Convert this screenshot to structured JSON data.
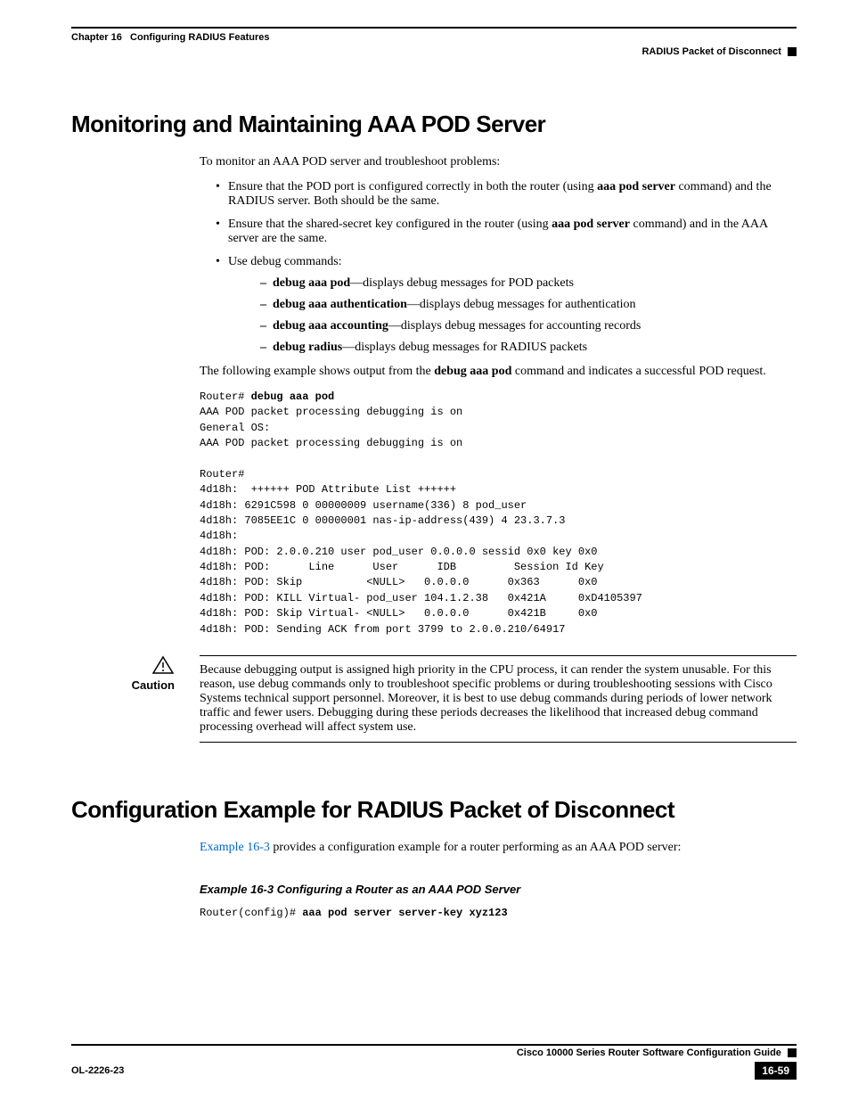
{
  "header": {
    "chapter": "Chapter 16",
    "chapter_title": "Configuring RADIUS Features",
    "section": "RADIUS Packet of Disconnect"
  },
  "h1_a": "Monitoring and Maintaining AAA POD Server",
  "intro_a": "To monitor an AAA POD server and troubleshoot problems:",
  "bullet1_pre": "Ensure that the POD port is configured correctly in both the router (using ",
  "bullet1_cmd": "aaa pod server",
  "bullet1_post": " command) and the RADIUS server. Both should be the same.",
  "bullet2_pre": "Ensure that the shared-secret key configured in the router (using ",
  "bullet2_cmd": "aaa pod server",
  "bullet2_post": " command) and in the AAA server are the same.",
  "bullet3": "Use debug commands:",
  "sub1_cmd": "debug aaa pod",
  "sub1_desc": "—displays debug messages for POD packets",
  "sub2_cmd": "debug aaa authentication",
  "sub2_desc": "—displays debug messages for authentication",
  "sub3_cmd": "debug aaa accounting",
  "sub3_desc": "—displays debug messages for accounting records",
  "sub4_cmd": "debug radius",
  "sub4_desc": "—displays debug messages for RADIUS packets",
  "example_lead_pre": "The following example shows output from the ",
  "example_lead_cmd": "debug aaa pod",
  "example_lead_post": " command and indicates a successful POD request.",
  "code_prompt": "Router# ",
  "code_cmd": "debug aaa pod",
  "code_body": "AAA POD packet processing debugging is on\nGeneral OS:\nAAA POD packet processing debugging is on\n\nRouter#\n4d18h:  ++++++ POD Attribute List ++++++\n4d18h: 6291C598 0 00000009 username(336) 8 pod_user\n4d18h: 7085EE1C 0 00000001 nas-ip-address(439) 4 23.3.7.3\n4d18h:\n4d18h: POD: 2.0.0.210 user pod_user 0.0.0.0 sessid 0x0 key 0x0\n4d18h: POD:      Line      User      IDB         Session Id Key\n4d18h: POD: Skip          <NULL>   0.0.0.0      0x363      0x0\n4d18h: POD: KILL Virtual- pod_user 104.1.2.38   0x421A     0xD4105397\n4d18h: POD: Skip Virtual- <NULL>   0.0.0.0      0x421B     0x0\n4d18h: POD: Sending ACK from port 3799 to 2.0.0.210/64917",
  "caution_label": "Caution",
  "caution_text": "Because debugging output is assigned high priority in the CPU process, it can render the system unusable. For this reason, use debug commands only to troubleshoot specific problems or during troubleshooting sessions with Cisco Systems technical support personnel. Moreover, it is best to use debug commands during periods of lower network traffic and fewer users. Debugging during these periods decreases the likelihood that increased debug command processing overhead will affect system use.",
  "h1_b": "Configuration Example for RADIUS Packet of Disconnect",
  "conf_link": "Example 16-3",
  "conf_text": " provides a configuration example for a router performing as an AAA POD server:",
  "example_title": "Example 16-3   Configuring a Router as an AAA POD Server",
  "conf_prompt": "Router(config)# ",
  "conf_cmd": "aaa pod server server-key xyz123",
  "footer": {
    "guide": "Cisco 10000 Series Router Software Configuration Guide",
    "docid": "OL-2226-23",
    "pagenum": "16-59"
  }
}
